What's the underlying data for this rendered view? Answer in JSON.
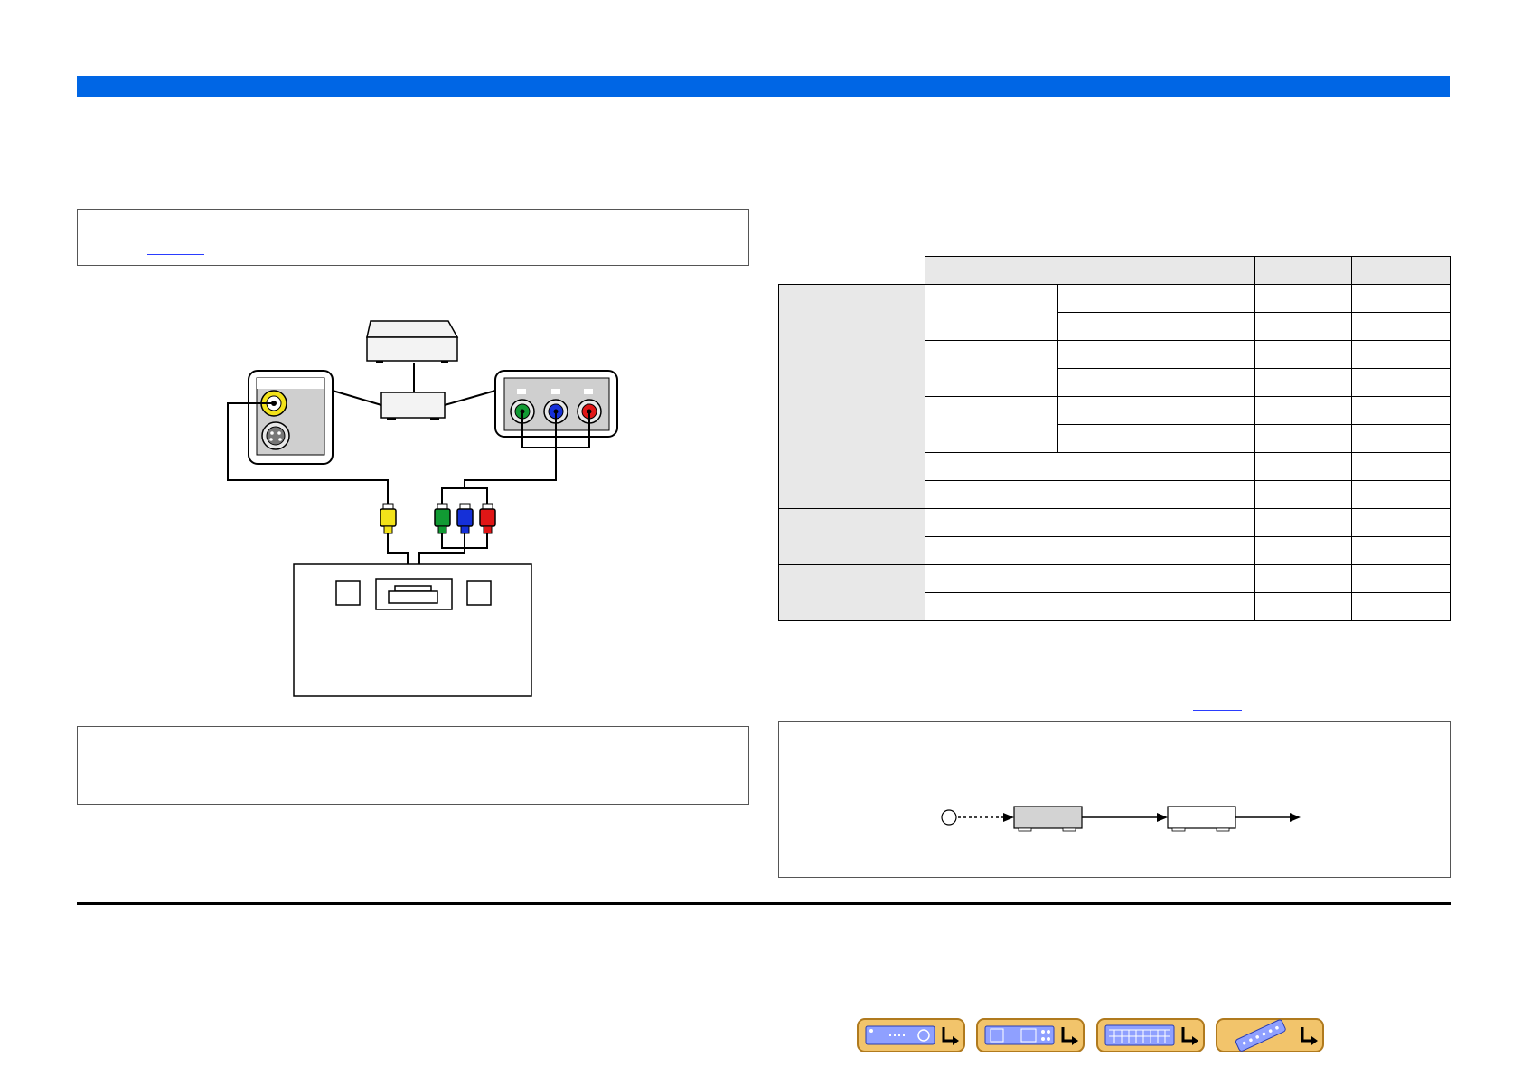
{
  "header": {
    "band_color": "#0066e5"
  },
  "diagram": {
    "plug_colors": {
      "video": "#f2e21a",
      "y": "#119a33",
      "pb": "#1530d8",
      "pr": "#e01616"
    }
  },
  "nav_buttons": [
    {
      "icon": "receiver-front-panel-icon"
    },
    {
      "icon": "receiver-rear-panel-icon"
    },
    {
      "icon": "receiver-display-icon"
    },
    {
      "icon": "remote-control-icon"
    }
  ],
  "colors": {
    "nav_button_fill": "#f2c46b",
    "nav_button_border": "#b07a1e",
    "table_header_fill": "#e8e8e8"
  }
}
